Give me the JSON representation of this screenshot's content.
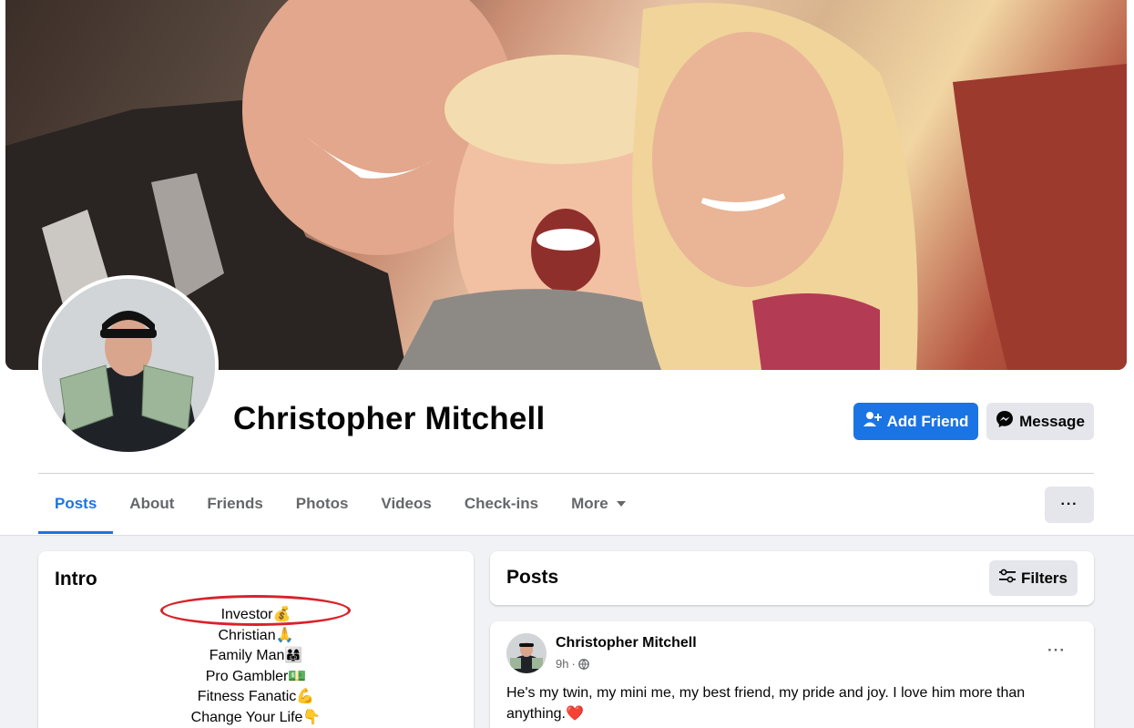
{
  "profile": {
    "name": "Christopher Mitchell",
    "add_friend_label": "Add Friend",
    "message_label": "Message"
  },
  "tabs": [
    {
      "label": "Posts",
      "active": true
    },
    {
      "label": "About"
    },
    {
      "label": "Friends"
    },
    {
      "label": "Photos"
    },
    {
      "label": "Videos"
    },
    {
      "label": "Check-ins"
    },
    {
      "label": "More"
    }
  ],
  "more_menu_label": "···",
  "intro": {
    "title": "Intro",
    "lines": [
      "Investor💰",
      "Christian🙏",
      "Family Man👨‍👩‍👧",
      "Pro Gambler💵",
      "Fitness Fanatic💪",
      "Change Your Life👇"
    ]
  },
  "posts_header": {
    "title": "Posts",
    "filters_label": "Filters"
  },
  "post": {
    "author": "Christopher Mitchell",
    "time": "9h",
    "audience_icon": "globe-icon",
    "menu_label": "···",
    "text": "He's my twin, my mini me, my best friend, my pride and joy. I love him more than anything.",
    "text_emoji": "❤️"
  },
  "colors": {
    "primary": "#1b74e4",
    "annotation": "#d8232a",
    "background": "#f0f2f5"
  }
}
